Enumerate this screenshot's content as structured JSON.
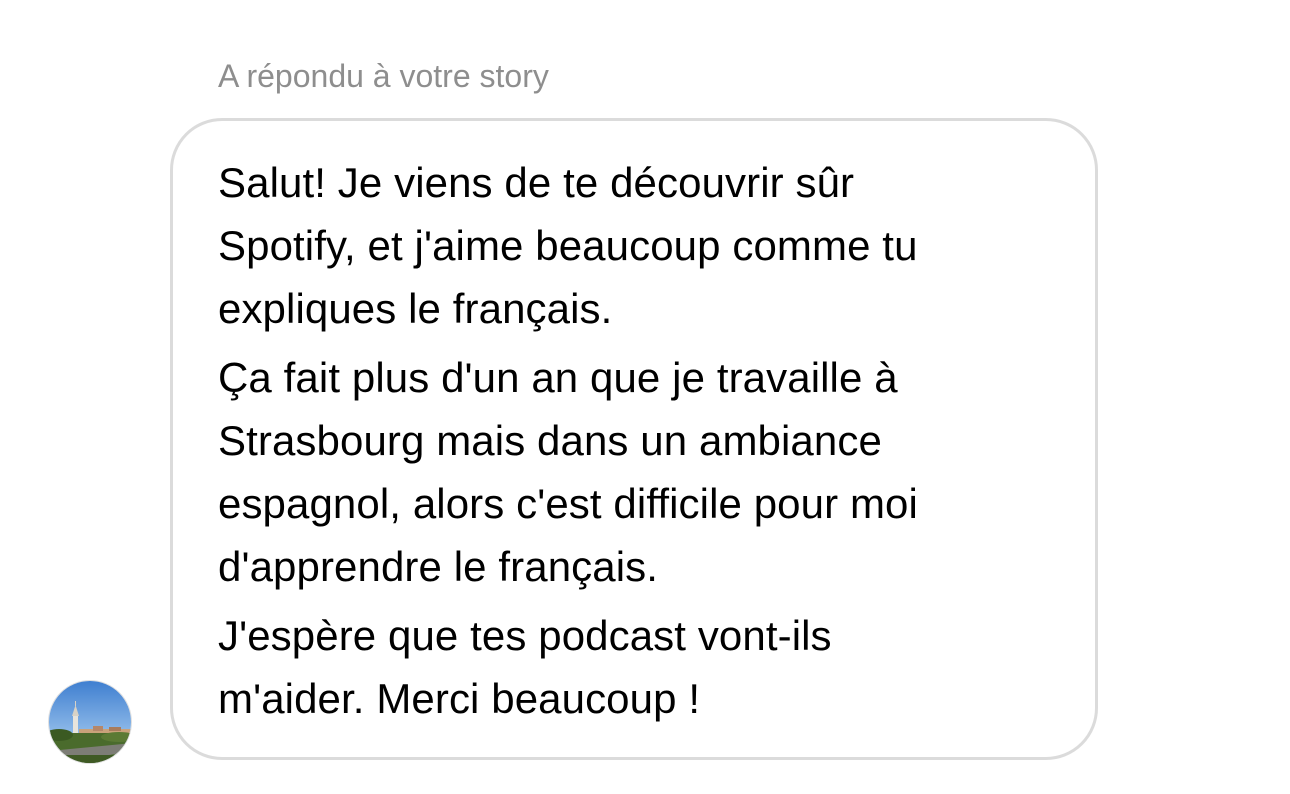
{
  "story_reply": {
    "caption": "A répondu à votre story"
  },
  "message": {
    "paragraphs": [
      {
        "lines": [
          "Salut! Je viens de te découvrir sûr",
          "Spotify, et j'aime beaucoup comme tu",
          "expliques le français."
        ]
      },
      {
        "lines": [
          "Ça fait plus d'un an que je travaille à",
          "Strasbourg mais dans un ambiance",
          "espagnol, alors c'est difficile pour moi",
          "d'apprendre le français."
        ]
      },
      {
        "lines": [
          "J'espère que tes podcast vont-ils",
          "m'aider. Merci beaucoup !"
        ]
      }
    ]
  },
  "sender": {
    "avatar_icon": "profile-photo-church-landscape"
  },
  "colors": {
    "caption": "#8e8e8e",
    "bubble_border": "#dbdbdb",
    "text": "#000000"
  }
}
